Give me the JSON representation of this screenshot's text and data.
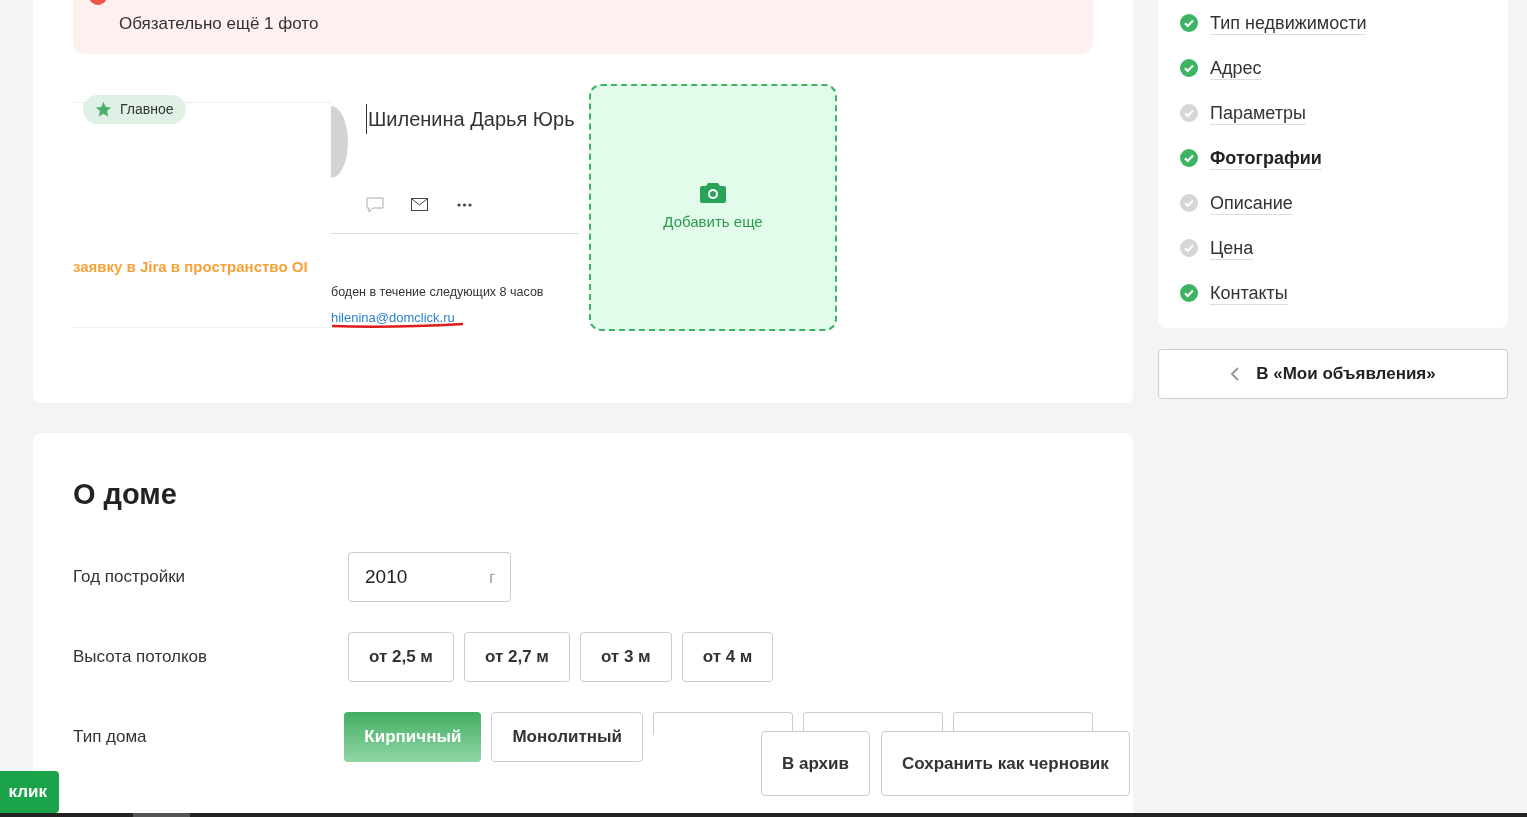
{
  "alert": {
    "text": "Обязательно ещё 1 фото"
  },
  "photos": [
    {
      "badge": "Главное",
      "texts": [
        "заявку в Jira в пространство OI"
      ]
    },
    {
      "name": "Шиленина Дарья Юрь",
      "status": "боден в течение следующих 8 часов",
      "email": "hilenina@domclick.ru"
    }
  ],
  "add_photo": "Добавить еще",
  "house": {
    "title": "О доме",
    "year": {
      "label": "Год постройки",
      "value": "2010",
      "suffix": "г"
    },
    "ceiling": {
      "label": "Высота потолков",
      "options": [
        {
          "label": "от 2,5 м",
          "selected": false
        },
        {
          "label": "от 2,7 м",
          "selected": false
        },
        {
          "label": "от 3 м",
          "selected": false
        },
        {
          "label": "от 4 м",
          "selected": false
        }
      ]
    },
    "type": {
      "label": "Тип дома",
      "options": [
        {
          "label": "Кирпичный",
          "selected": true
        },
        {
          "label": "Монолитный",
          "selected": false
        },
        {
          "selected": false
        },
        {
          "selected": false
        },
        {
          "selected": false
        }
      ]
    }
  },
  "nav": [
    {
      "label": "Тип недвижимости",
      "done": true,
      "selected": false
    },
    {
      "label": "Адрес",
      "done": true,
      "selected": false
    },
    {
      "label": "Параметры",
      "done": false,
      "selected": false
    },
    {
      "label": "Фотографии",
      "done": true,
      "selected": true
    },
    {
      "label": "Описание",
      "done": false,
      "selected": false
    },
    {
      "label": "Цена",
      "done": false,
      "selected": false
    },
    {
      "label": "Контакты",
      "done": true,
      "selected": false
    }
  ],
  "back_button": "В «Мои объявления»",
  "actions": [
    "В архив",
    "Сохранить как черновик"
  ],
  "side_tab": "клик"
}
